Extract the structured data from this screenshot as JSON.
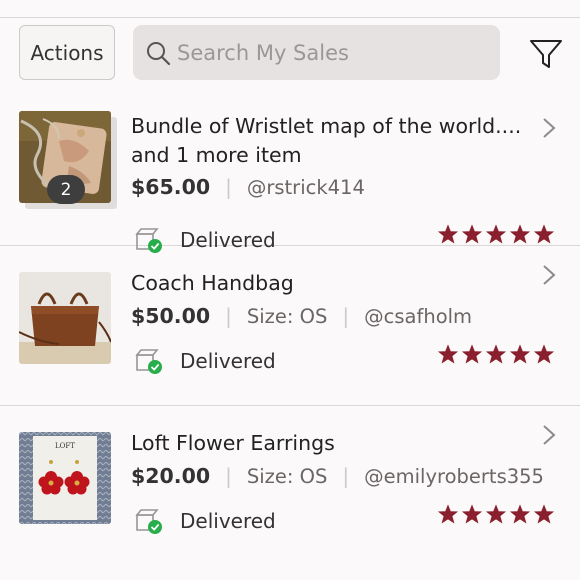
{
  "toolbar": {
    "actions_label": "Actions",
    "search_placeholder": "Search My Sales"
  },
  "colors": {
    "star": "#8a1f2d",
    "delivered_check": "#27ae4a",
    "search_bg": "#e6e2e2"
  },
  "icons": {
    "search": "search-icon",
    "filter": "filter-icon",
    "chevron": "chevron-right-icon",
    "delivered": "delivered-box-icon",
    "star": "star-icon"
  },
  "sales": [
    {
      "title": "Bundle of Wristlet map of the world.... and 1 more item",
      "price": "$65.00",
      "size": "",
      "seller": "@rstrick414",
      "status": "Delivered",
      "rating": 5,
      "bundle_count": "2"
    },
    {
      "title": "Coach Handbag",
      "price": "$50.00",
      "size": "Size: OS",
      "seller": "@csafholm",
      "status": "Delivered",
      "rating": 5,
      "bundle_count": ""
    },
    {
      "title": "Loft Flower Earrings",
      "price": "$20.00",
      "size": "Size: OS",
      "seller": "@emilyroberts355",
      "status": "Delivered",
      "rating": 5,
      "bundle_count": ""
    }
  ]
}
